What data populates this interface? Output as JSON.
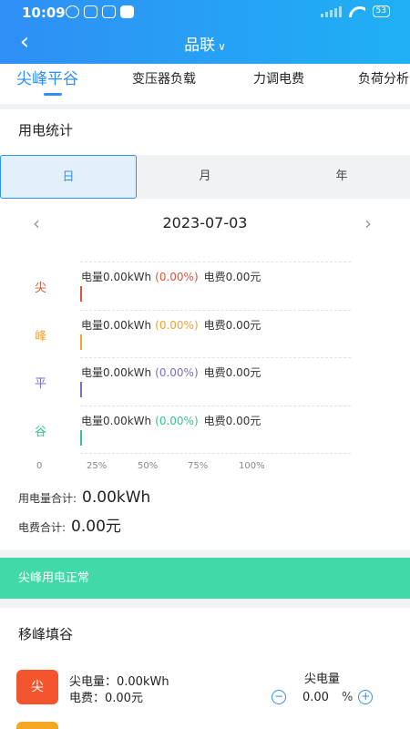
{
  "status_bar": {
    "time": "10:09",
    "battery": "53"
  },
  "header": {
    "title": "品联",
    "back_icon": "chevron-left-icon",
    "dropdown_icon": "chevron-down-icon"
  },
  "tabs": [
    {
      "label": "尖峰平谷",
      "active": true
    },
    {
      "label": "变压器负载"
    },
    {
      "label": "力调电费"
    },
    {
      "label": "负荷分析"
    }
  ],
  "usage_section": {
    "title": "用电统计",
    "period_options": [
      "日",
      "月",
      "年"
    ],
    "selected_period": "日",
    "date": "2023-07-03"
  },
  "chart_data": {
    "type": "bar",
    "orientation": "horizontal",
    "categories": [
      "尖",
      "峰",
      "平",
      "谷"
    ],
    "values": [
      0,
      0,
      0,
      0
    ],
    "energy_labels": [
      "电量0.00kWh",
      "电量0.00kWh",
      "电量0.00kWh",
      "电量0.00kWh"
    ],
    "percent_labels": [
      "(0.00%)",
      "(0.00%)",
      "(0.00%)",
      "(0.00%)"
    ],
    "cost_labels": [
      "电费0.00元",
      "电费0.00元",
      "电费0.00元",
      "电费0.00元"
    ],
    "colors": [
      "#e0533a",
      "#f0a233",
      "#7b6cc9",
      "#33c39a"
    ],
    "x_ticks": [
      "0",
      "25%",
      "50%",
      "75%",
      "100%"
    ],
    "xlim": [
      0,
      100
    ]
  },
  "totals": {
    "energy_label": "用电量合计:",
    "energy_value": "0.00kWh",
    "cost_label": "电费合计:",
    "cost_value": "0.00元"
  },
  "status_banner": {
    "text": "尖峰用电正常",
    "color": "#41d9a8"
  },
  "shift_section": {
    "title": "移峰填谷",
    "items": [
      {
        "badge": "尖",
        "energy_line": "尖电量：0.00kWh",
        "cost_line": "电费：0.00元",
        "control_label": "尖电量",
        "control_value": "0.00",
        "control_unit": "%",
        "color": "#f3552f"
      }
    ]
  }
}
